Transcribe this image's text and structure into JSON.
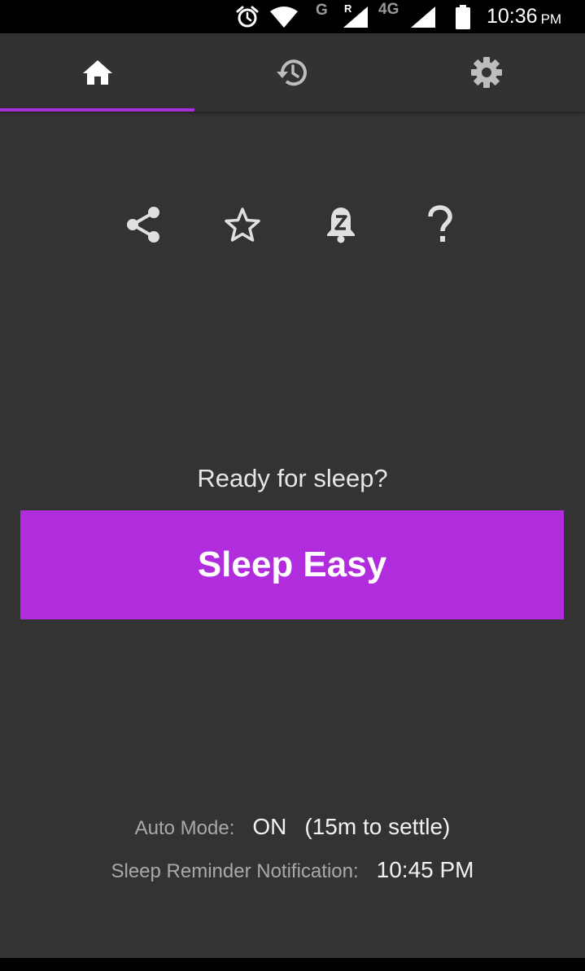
{
  "status_bar": {
    "network_g": "G",
    "roaming": "R",
    "network_4g": "4G",
    "time": "10:36",
    "ampm": "PM",
    "icons": [
      "alarm-icon",
      "wifi-icon",
      "signal-icon",
      "signal-icon",
      "battery-icon"
    ]
  },
  "tabs": [
    {
      "name": "home",
      "icon": "home-icon",
      "selected": true
    },
    {
      "name": "history",
      "icon": "history-icon",
      "selected": false
    },
    {
      "name": "settings",
      "icon": "gear-icon",
      "selected": false
    }
  ],
  "actions": [
    "share-icon",
    "star-icon",
    "snooze-bell-icon",
    "help-icon"
  ],
  "main": {
    "prompt": "Ready for sleep?",
    "button_label": "Sleep Easy"
  },
  "info": {
    "auto_mode_label": "Auto Mode:",
    "auto_mode_value": "ON",
    "auto_mode_detail": "(15m to settle)",
    "reminder_label": "Sleep Reminder Notification:",
    "reminder_value": "10:45 PM"
  },
  "colors": {
    "accent": "#b02cdc",
    "indicator": "#a82fd6",
    "background": "#333333"
  }
}
